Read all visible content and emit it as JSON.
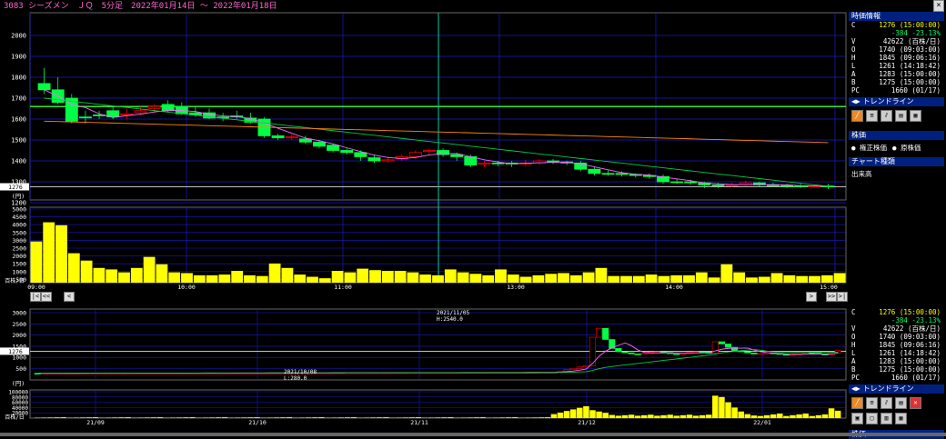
{
  "window": {
    "title": "3083 シーズメン　ＪＱ　5分足　2022年01月14日 ～ 2022年01月18日",
    "close_label": "×"
  },
  "info_panel": {
    "header": "時価情報",
    "rows": [
      {
        "k": "C",
        "v": "1276 (15:00:00)",
        "color": "#ffff00"
      },
      {
        "k": "",
        "v": "-384 -23.13%",
        "color": "#00ff66"
      },
      {
        "k": "V",
        "v": "42622 (百株/日)",
        "color": "#ffffff"
      },
      {
        "k": "O",
        "v": "1740 (09:03:00)",
        "color": "#ffffff"
      },
      {
        "k": "H",
        "v": "1845 (09:06:16)",
        "color": "#ffffff"
      },
      {
        "k": "L",
        "v": "1261 (14:18:42)",
        "color": "#ffffff"
      },
      {
        "k": "A",
        "v": "1283 (15:00:00)",
        "color": "#ffffff"
      },
      {
        "k": "B",
        "v": "1275 (15:00:00)",
        "color": "#ffffff"
      },
      {
        "k": "PC",
        "v": "1660 (01/17)",
        "color": "#ffffff"
      }
    ],
    "trendline_label": "トレンドライン",
    "stock_price_header": "株価",
    "radio_adjusted": "権正株価",
    "radio_raw": "原株価",
    "chart_type_header": "チャート種類",
    "chart_type_value": "出来高"
  },
  "info_panel2": {
    "rows": [
      {
        "k": "C",
        "v": "1276 (15:00:00)",
        "color": "#ffff00"
      },
      {
        "k": "",
        "v": "-384 -23.13%",
        "color": "#00ff66"
      },
      {
        "k": "V",
        "v": "42622 (百株/日)",
        "color": "#ffffff"
      },
      {
        "k": "O",
        "v": "1740 (09:03:00)",
        "color": "#ffffff"
      },
      {
        "k": "H",
        "v": "1845 (09:06:16)",
        "color": "#ffffff"
      },
      {
        "k": "L",
        "v": "1261 (14:18:42)",
        "color": "#ffffff"
      },
      {
        "k": "A",
        "v": "1283 (15:00:00)",
        "color": "#ffffff"
      },
      {
        "k": "B",
        "v": "1275 (15:00:00)",
        "color": "#ffffff"
      },
      {
        "k": "PC",
        "v": "1660 (01/17)",
        "color": "#ffffff"
      }
    ],
    "trendline_label": "トレンドライン",
    "stock_price_header": "株価"
  },
  "top_chart": {
    "price_ticks": [
      "2000",
      "1900",
      "1800",
      "1700",
      "1600",
      "1500",
      "1400",
      "1300",
      "1200"
    ],
    "current_price_label": "1276",
    "unit_label": "(円)",
    "volume_ticks": [
      "5000",
      "4500",
      "4000",
      "3500",
      "3000",
      "2500",
      "2000",
      "1500",
      "1000",
      "500"
    ],
    "volume_unit": "百株/日",
    "time_labels": [
      "09:00",
      "10:00",
      "11:00",
      "13:00",
      "14:00",
      "15:00"
    ]
  },
  "bottom_chart": {
    "price_ticks": [
      "3000",
      "2500",
      "2000",
      "1500",
      "1000",
      "500"
    ],
    "current_price_label": "1276",
    "unit_label": "(円)",
    "volume_ticks": [
      "100000",
      "80000",
      "60000",
      "40000",
      "20000"
    ],
    "volume_unit": "百株/日",
    "date_labels": [
      "21/09",
      "21/10",
      "21/11",
      "21/12",
      "22/01"
    ],
    "high_annotation_date": "2021/11/05",
    "high_annotation_value": "H:2540.0",
    "low_annotation_date": "2021/10/08",
    "low_annotation_value": "L:280.0"
  },
  "nav": {
    "first": "|<",
    "prev_fast": "<<",
    "prev": "<",
    "next": ">",
    "next_fast": ">>",
    "last": ">|"
  },
  "colors": {
    "bull": "#00ff44",
    "bear": "#ff0000",
    "volume": "#ffff00",
    "grid": "#1a1acc",
    "cursor": "#00ccaa",
    "ma_short": "#ff66ff",
    "ma_mid": "#00cc44",
    "ma_long": "#ff8800"
  }
}
